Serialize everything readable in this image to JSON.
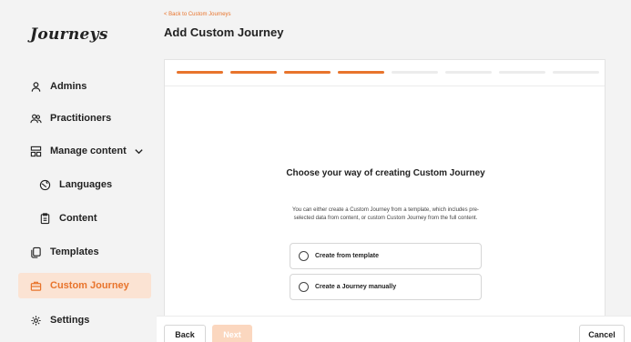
{
  "app": {
    "logo": "Journeys"
  },
  "sidebar": {
    "items": [
      {
        "label": "Admins",
        "icon": "user-icon"
      },
      {
        "label": "Practitioners",
        "icon": "users-icon"
      },
      {
        "label": "Manage content",
        "icon": "grid-icon",
        "expanded": true
      },
      {
        "label": "Languages",
        "icon": "globe-icon"
      },
      {
        "label": "Content",
        "icon": "document-icon"
      },
      {
        "label": "Templates",
        "icon": "copy-icon"
      },
      {
        "label": "Custom Journey",
        "icon": "briefcase-icon",
        "active": true
      },
      {
        "label": "Settings",
        "icon": "gear-icon"
      }
    ]
  },
  "header": {
    "back_link": "< Back to Custom Journeys",
    "title": "Add Custom Journey"
  },
  "wizard": {
    "steps_total": 8,
    "steps_completed": 4,
    "title": "Choose your way of creating Custom Journey",
    "description": "You can either create a Custom Journey from a template, which includes pre-selected data from content, or custom Custom Journey from the full content.",
    "options": [
      {
        "label": "Create from template",
        "selected": false
      },
      {
        "label": "Create a Journey manually",
        "selected": false
      }
    ]
  },
  "footer": {
    "back_label": "Back",
    "next_label": "Next",
    "cancel_label": "Cancel"
  },
  "colors": {
    "accent": "#e8742c",
    "active_bg": "#fbe3d3",
    "next_disabled": "#fbd7bf"
  }
}
